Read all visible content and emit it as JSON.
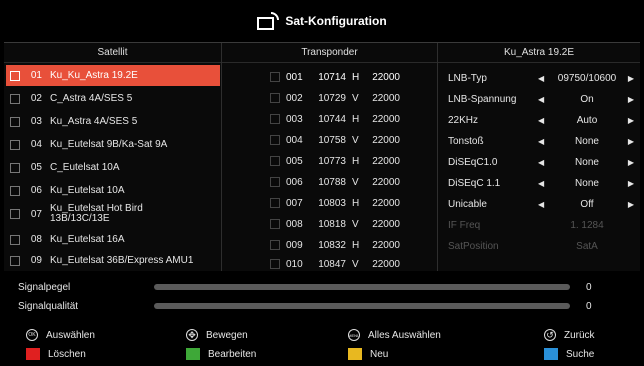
{
  "header": {
    "title": "Sat-Konfiguration"
  },
  "satellites": {
    "title": "Satellit",
    "items": [
      {
        "num": "01",
        "name": "Ku_Ku_Astra 19.2E",
        "selected": true
      },
      {
        "num": "02",
        "name": "C_Astra 4A/SES 5"
      },
      {
        "num": "03",
        "name": "Ku_Astra 4A/SES 5"
      },
      {
        "num": "04",
        "name": "Ku_Eutelsat 9B/Ka-Sat 9A"
      },
      {
        "num": "05",
        "name": "C_Eutelsat 10A"
      },
      {
        "num": "06",
        "name": "Ku_Eutelsat 10A"
      },
      {
        "num": "07",
        "name": "Ku_Eutelsat Hot Bird 13B/13C/13E"
      },
      {
        "num": "08",
        "name": "Ku_Eutelsat 16A"
      },
      {
        "num": "09",
        "name": "Ku_Eutelsat 36B/Express AMU1"
      }
    ]
  },
  "transponders": {
    "title": "Transponder",
    "items": [
      {
        "num": "001",
        "freq": "10714",
        "pol": "H",
        "sym": "22000"
      },
      {
        "num": "002",
        "freq": "10729",
        "pol": "V",
        "sym": "22000"
      },
      {
        "num": "003",
        "freq": "10744",
        "pol": "H",
        "sym": "22000"
      },
      {
        "num": "004",
        "freq": "10758",
        "pol": "V",
        "sym": "22000"
      },
      {
        "num": "005",
        "freq": "10773",
        "pol": "H",
        "sym": "22000"
      },
      {
        "num": "006",
        "freq": "10788",
        "pol": "V",
        "sym": "22000"
      },
      {
        "num": "007",
        "freq": "10803",
        "pol": "H",
        "sym": "22000"
      },
      {
        "num": "008",
        "freq": "10818",
        "pol": "V",
        "sym": "22000"
      },
      {
        "num": "009",
        "freq": "10832",
        "pol": "H",
        "sym": "22000"
      },
      {
        "num": "010",
        "freq": "10847",
        "pol": "V",
        "sym": "22000"
      }
    ]
  },
  "settings": {
    "title": "Ku_Astra 19.2E",
    "items": [
      {
        "label": "LNB-Typ",
        "value": "09750/10600"
      },
      {
        "label": "LNB-Spannung",
        "value": "On"
      },
      {
        "label": "22KHz",
        "value": "Auto"
      },
      {
        "label": "Tonstoß",
        "value": "None"
      },
      {
        "label": "DiSEqC1.0",
        "value": "None"
      },
      {
        "label": "DiSEqC 1.1",
        "value": "None"
      },
      {
        "label": "Unicable",
        "value": "Off"
      },
      {
        "label": "IF Freq",
        "value": "1. 1284",
        "disabled": true
      },
      {
        "label": "SatPosition",
        "value": "SatA",
        "disabled": true
      }
    ]
  },
  "signal": {
    "level_label": "Signalpegel",
    "level_value": "0",
    "quality_label": "Signalqualität",
    "quality_value": "0"
  },
  "legend": {
    "ok_badge": "OK",
    "ok_label": "Auswählen",
    "move_label": "Bewegen",
    "all_badge": "MENU",
    "all_label": "Alles Auswählen",
    "back_label": "Zurück",
    "red_label": "Löschen",
    "red_color": "#e02020",
    "green_label": "Bearbeiten",
    "green_color": "#3ea838",
    "yellow_label": "Neu",
    "yellow_color": "#e8b820",
    "blue_label": "Suche",
    "blue_color": "#2a90d8"
  }
}
